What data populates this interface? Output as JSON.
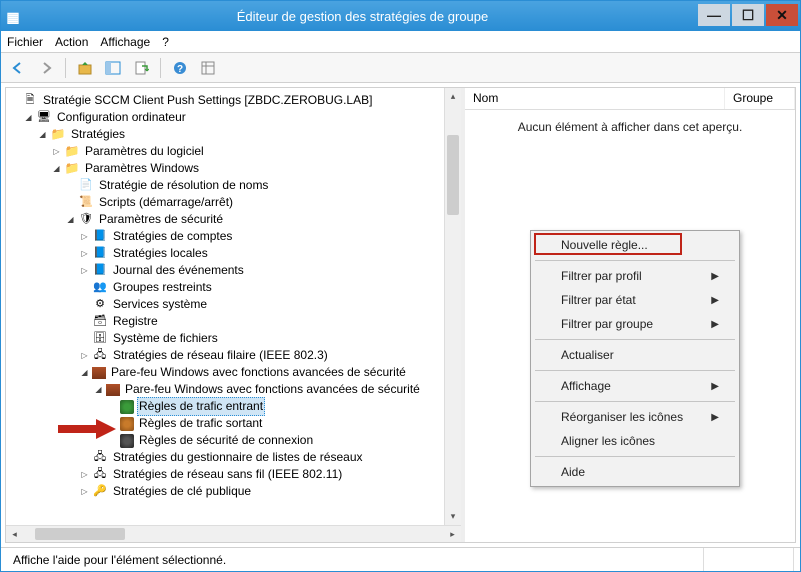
{
  "window": {
    "title": "Éditeur de gestion des stratégies de groupe"
  },
  "menubar": {
    "file": "Fichier",
    "action": "Action",
    "view": "Affichage",
    "help": "?"
  },
  "tree": {
    "root": "Stratégie SCCM Client Push Settings [ZBDC.ZEROBUG.LAB]",
    "computer_config": "Configuration ordinateur",
    "policies": "Stratégies",
    "software_settings": "Paramètres du logiciel",
    "windows_settings": "Paramètres Windows",
    "name_resolution": "Stratégie de résolution de noms",
    "scripts": "Scripts (démarrage/arrêt)",
    "security_settings": "Paramètres de sécurité",
    "account_policies": "Stratégies de comptes",
    "local_policies": "Stratégies locales",
    "event_log": "Journal des événements",
    "restricted_groups": "Groupes restreints",
    "system_services": "Services système",
    "registry": "Registre",
    "file_system": "Système de fichiers",
    "wired_network": "Stratégies de réseau filaire (IEEE 802.3)",
    "firewall_adv": "Pare-feu Windows avec fonctions avancées de sécurité",
    "firewall_adv_inner": "Pare-feu Windows avec fonctions avancées de sécurité",
    "inbound_rules": "Règles de trafic entrant",
    "outbound_rules": "Règles de trafic sortant",
    "connection_security": "Règles de sécurité de connexion",
    "network_list_mgr": "Stratégies du gestionnaire de listes de réseaux",
    "wireless_network": "Stratégies de réseau sans fil (IEEE 802.11)",
    "public_key": "Stratégies de clé publique"
  },
  "listview": {
    "col_name": "Nom",
    "col_group": "Groupe",
    "empty_msg": "Aucun élément à afficher dans cet aperçu."
  },
  "context_menu": {
    "new_rule": "Nouvelle règle...",
    "filter_profile": "Filtrer par profil",
    "filter_state": "Filtrer par état",
    "filter_group": "Filtrer par groupe",
    "refresh": "Actualiser",
    "view": "Affichage",
    "rearrange_icons": "Réorganiser les icônes",
    "align_icons": "Aligner les icônes",
    "help": "Aide"
  },
  "statusbar": {
    "text": "Affiche l'aide pour l'élément sélectionné."
  }
}
